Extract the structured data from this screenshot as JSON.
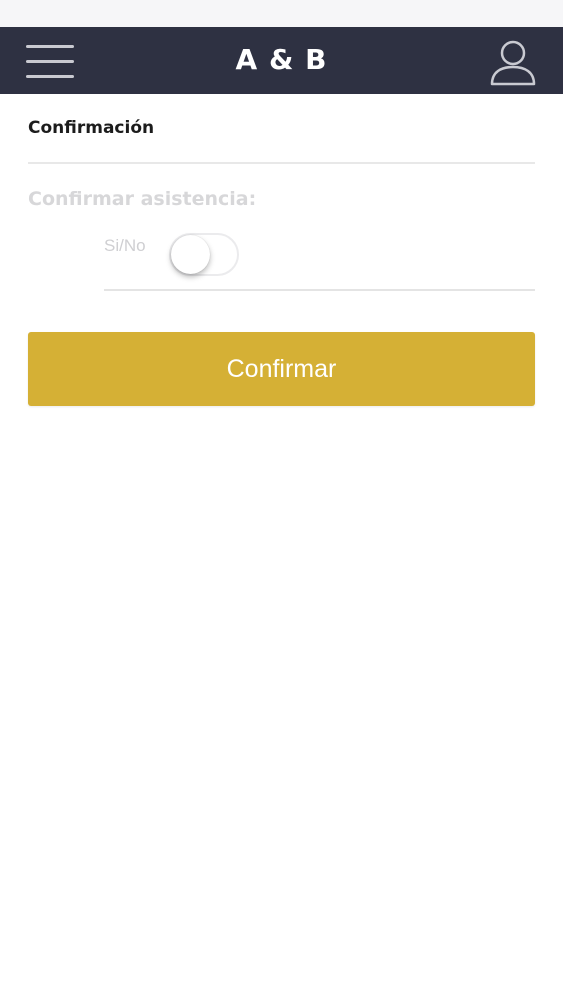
{
  "status_bar": {
    "carrier": "",
    "time": "",
    "battery": ""
  },
  "nav": {
    "title": "A & B",
    "menu_icon": "hamburger-menu-icon",
    "profile_icon": "user-profile-icon",
    "background_color": "#2e3142"
  },
  "section": {
    "title": "Confirmación"
  },
  "attendance": {
    "label": "Confirmar asistencia:",
    "toggle_label": "Si/No",
    "toggle_on": false
  },
  "actions": {
    "confirm_label": "Confirmar",
    "confirm_color": "#d5b035"
  }
}
